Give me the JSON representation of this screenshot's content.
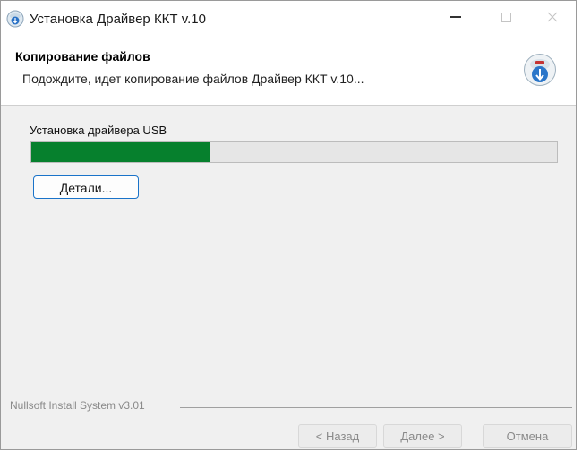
{
  "window": {
    "title": "Установка Драйвер ККТ v.10"
  },
  "header": {
    "title": "Копирование файлов",
    "subtitle": "Подождите, идет копирование файлов Драйвер ККТ v.10..."
  },
  "content": {
    "status_label": "Установка драйвера USB",
    "progress_fraction": 0.34,
    "progress_color": "#06802d",
    "details_label": "Детали..."
  },
  "footer": {
    "branding": "Nullsoft Install System v3.01",
    "back_label": "< Назад",
    "next_label": "Далее >",
    "cancel_label": "Отмена"
  },
  "icons": {
    "app": "installer-globe-icon",
    "header": "installer-globe-icon",
    "minimize": "minimize-icon",
    "maximize": "maximize-icon",
    "close": "close-icon"
  }
}
